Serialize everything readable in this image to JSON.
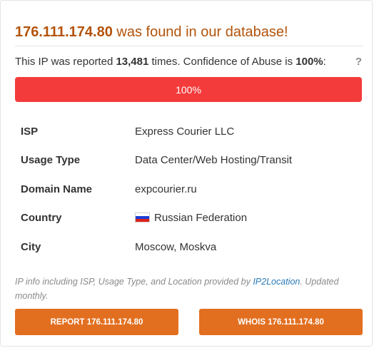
{
  "header": {
    "ip": "176.111.174.80",
    "found_text": " was found in our database!"
  },
  "report": {
    "prefix": "This IP was reported ",
    "count": "13,481",
    "middle": " times. Confidence of Abuse is ",
    "confidence": "100%",
    "suffix": ":",
    "help_glyph": "?"
  },
  "progress": {
    "value": 1.0,
    "label": "100%",
    "color": "#f43b3b"
  },
  "info": {
    "rows": [
      {
        "key": "ISP",
        "value": "Express Courier LLC"
      },
      {
        "key": "Usage Type",
        "value": "Data Center/Web Hosting/Transit"
      },
      {
        "key": "Domain Name",
        "value": "expcourier.ru"
      },
      {
        "key": "Country",
        "value": "Russian Federation",
        "icon": "russia-flag-icon"
      },
      {
        "key": "City",
        "value": "Moscow, Moskva"
      }
    ]
  },
  "footnote": {
    "before": "IP info including ISP, Usage Type, and Location provided by ",
    "link": "IP2Location",
    "after": ". Updated monthly."
  },
  "buttons": {
    "report_label": "REPORT 176.111.174.80",
    "whois_label": "WHOIS 176.111.174.80",
    "color": "#e26f20"
  },
  "colors": {
    "headline": "#b3530a",
    "link": "#2a7ab8"
  }
}
